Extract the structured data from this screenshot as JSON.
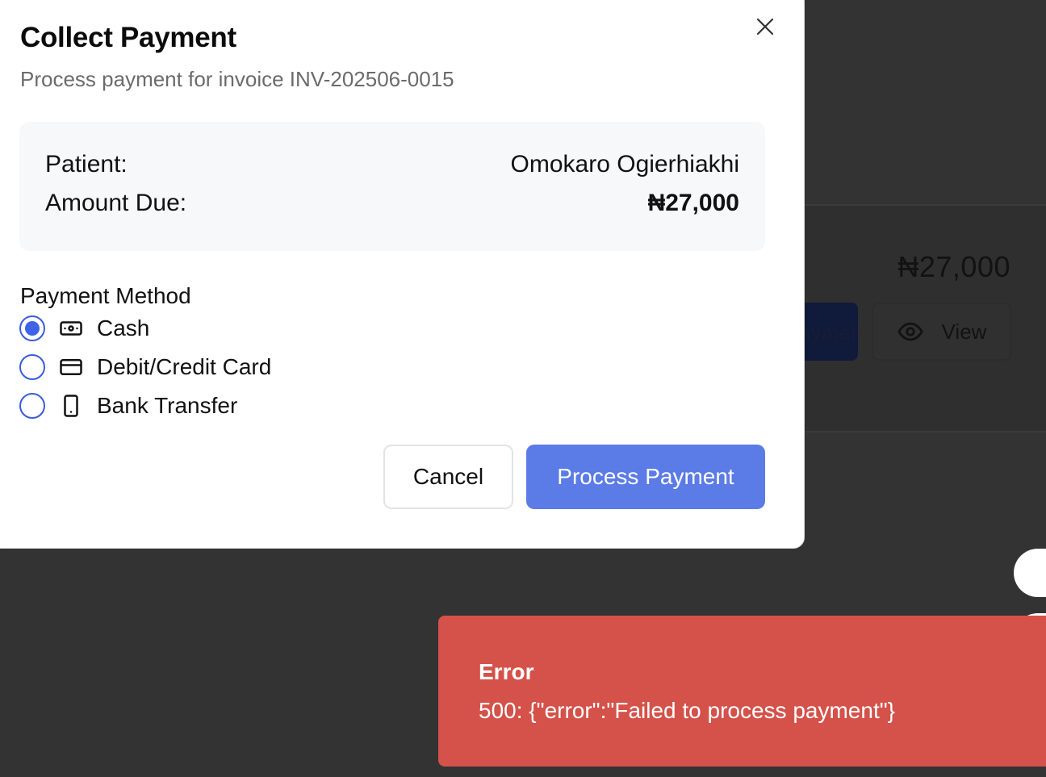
{
  "background": {
    "amount": "₦27,000",
    "record_button_label": "Record Payment",
    "view_button_label": "View"
  },
  "modal": {
    "title": "Collect Payment",
    "subtitle": "Process payment for invoice INV-202506-0015",
    "summary": {
      "patient_label": "Patient:",
      "patient_value": "Omokaro Ogierhiakhi",
      "amount_label": "Amount Due:",
      "amount_value": "₦27,000"
    },
    "payment_method": {
      "label": "Payment Method",
      "selected": "Cash",
      "options": [
        {
          "label": "Cash",
          "icon": "cash-icon"
        },
        {
          "label": "Debit/Credit Card",
          "icon": "credit-card-icon"
        },
        {
          "label": "Bank Transfer",
          "icon": "smartphone-icon"
        }
      ]
    },
    "cancel_label": "Cancel",
    "process_label": "Process Payment"
  },
  "toast": {
    "title": "Error",
    "message": "500: {\"error\":\"Failed to process payment\"}"
  },
  "colors": {
    "primary": "#5b7be6",
    "radio_accent": "#3f63e6",
    "error": "#d4524a",
    "overlay": "#333333"
  }
}
